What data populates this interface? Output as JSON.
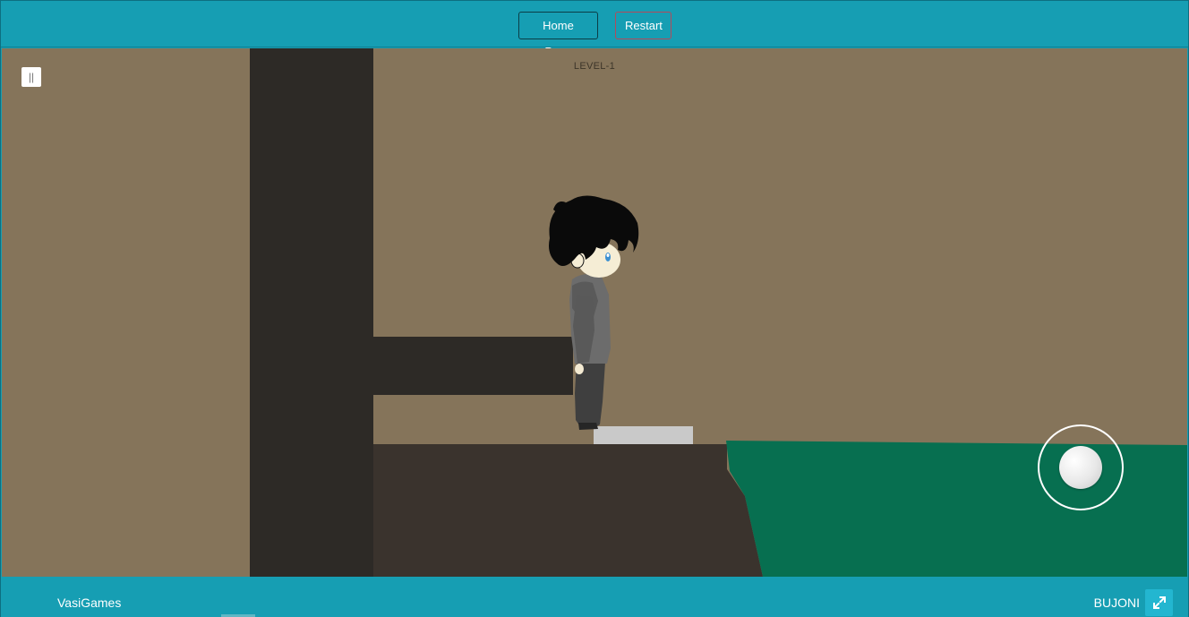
{
  "toolbar": {
    "home_label": "Home Page",
    "restart_label": "Restart"
  },
  "game": {
    "level_label": "LEVEL-1",
    "pause_label": "||"
  },
  "footer": {
    "brand": "VasiGames",
    "game_name": "BUJONI"
  },
  "icons": {
    "pause": "pause-icon",
    "fullscreen": "expand-icon",
    "joystick": "joystick-icon"
  },
  "colors": {
    "bar": "#169eb3",
    "background": "#85745a",
    "wall": "#2d2a26",
    "grass": "#076f50",
    "platform": "#c9c9c9"
  }
}
